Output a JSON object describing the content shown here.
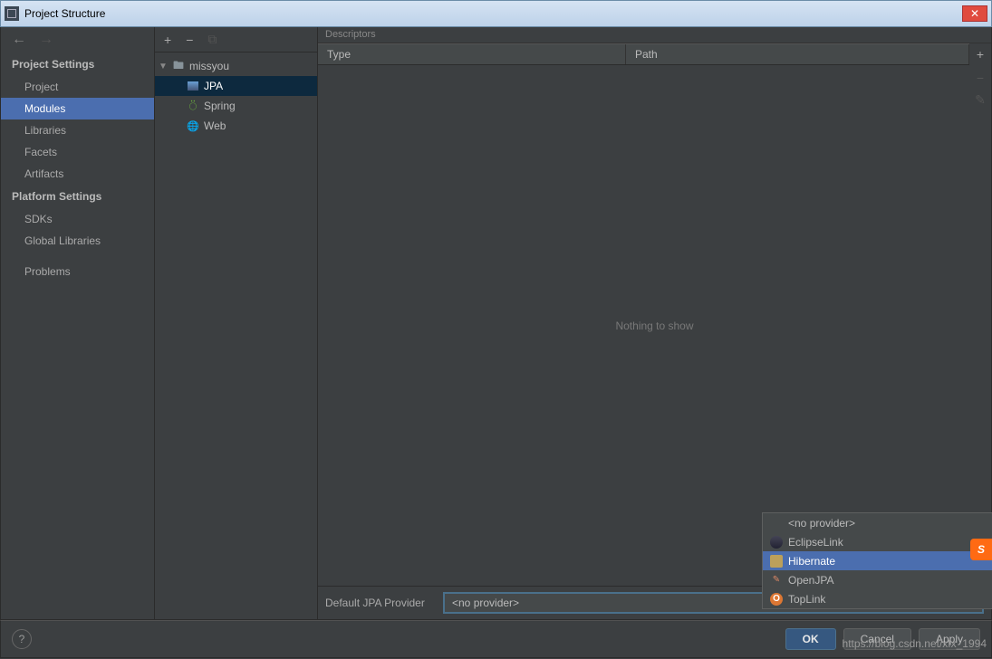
{
  "window": {
    "title": "Project Structure"
  },
  "sidebar": {
    "sections": [
      {
        "title": "Project Settings",
        "items": [
          "Project",
          "Modules",
          "Libraries",
          "Facets",
          "Artifacts"
        ],
        "selected": "Modules"
      },
      {
        "title": "Platform Settings",
        "items": [
          "SDKs",
          "Global Libraries"
        ]
      },
      {
        "title": "",
        "items": [
          "Problems"
        ]
      }
    ]
  },
  "tree": {
    "root": {
      "label": "missyou",
      "expanded": true
    },
    "children": [
      {
        "label": "JPA",
        "icon": "jpa",
        "selected": true
      },
      {
        "label": "Spring",
        "icon": "spring"
      },
      {
        "label": "Web",
        "icon": "web"
      }
    ]
  },
  "descriptors": {
    "title": "Descriptors",
    "columns": {
      "type": "Type",
      "path": "Path"
    },
    "empty": "Nothing to show"
  },
  "provider": {
    "label": "Default JPA Provider",
    "value": "<no provider>",
    "options": [
      {
        "label": "<no provider>",
        "icon": ""
      },
      {
        "label": "EclipseLink",
        "icon": "eclipse"
      },
      {
        "label": "Hibernate",
        "icon": "hibernate",
        "selected": true
      },
      {
        "label": "OpenJPA",
        "icon": "openjpa"
      },
      {
        "label": "TopLink",
        "icon": "toplink"
      }
    ]
  },
  "buttons": {
    "ok": "OK",
    "cancel": "Cancel",
    "apply": "Apply"
  },
  "watermark": "https://blog.csdn.net/xfx_1994",
  "badge": "S"
}
